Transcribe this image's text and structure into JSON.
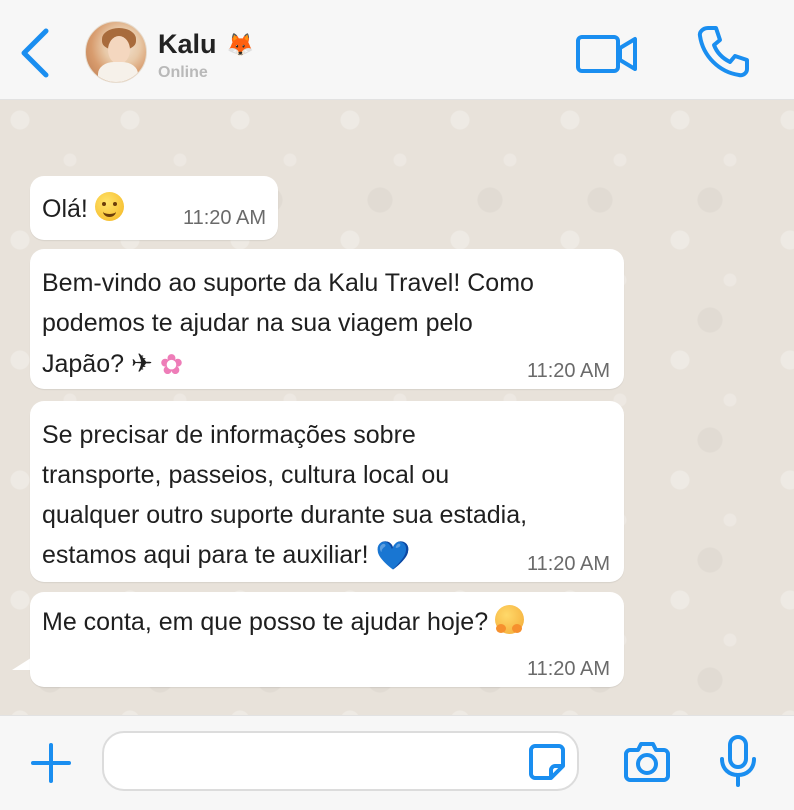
{
  "header": {
    "contact_name": "Kalu",
    "contact_status": "Online",
    "name_emoji": "🦊"
  },
  "messages": [
    {
      "text": "Olá!",
      "emoji": "smiling-face",
      "time": "11:20 AM"
    },
    {
      "lines": [
        "Bem-vindo ao suporte da Kalu Travel! Como",
        "podemos te ajudar na sua viagem pelo",
        "Japão?"
      ],
      "emojis": [
        "✈",
        "✿"
      ],
      "time": "11:20 AM"
    },
    {
      "lines": [
        "Se precisar de informações sobre",
        "transporte, passeios, cultura local ou",
        "qualquer outro suporte durante sua estadia,",
        "estamos aqui para te auxiliar!"
      ],
      "emoji": "💙",
      "time": "11:20 AM"
    },
    {
      "text": "Me conta, em que posso te ajudar hoje?",
      "emoji": "hugging-face",
      "time": "11:20 AM"
    }
  ],
  "composer": {
    "input_value": ""
  },
  "icons": {
    "back": "chevron-left-icon",
    "video": "video-camera-icon",
    "call": "phone-icon",
    "plus": "plus-icon",
    "sticker": "sticker-icon",
    "camera": "camera-icon",
    "mic": "microphone-icon"
  },
  "colors": {
    "accent": "#1a8ef0",
    "chat_background": "#e8e2da",
    "bubble": "#ffffff"
  }
}
